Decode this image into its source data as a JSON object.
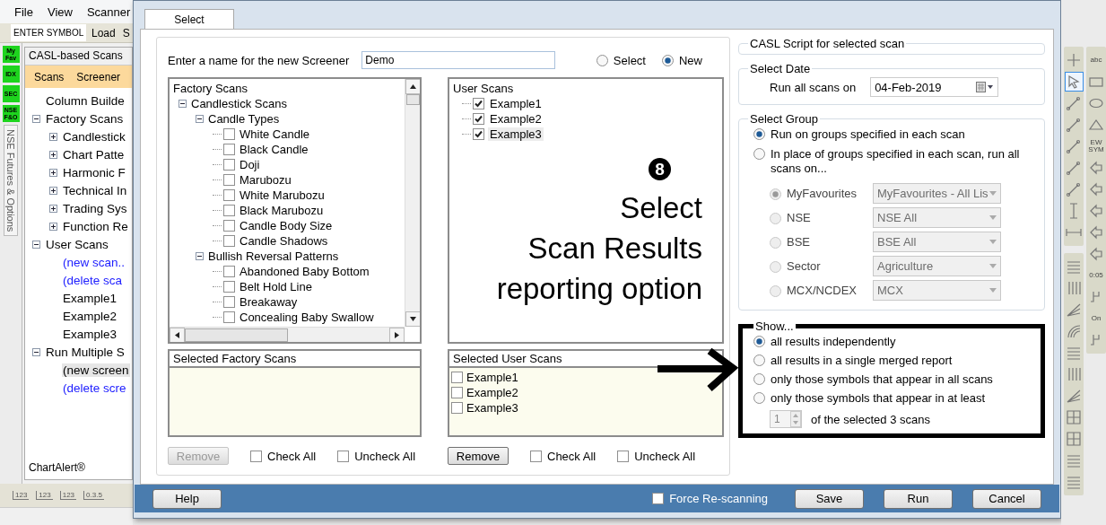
{
  "app": {
    "menu": [
      "File",
      "View",
      "Scanner"
    ],
    "symbol_field": {
      "placeholder": "ENTER SYMBOL"
    },
    "toolbar": [
      "Load",
      "S"
    ],
    "badges": [
      "My Fav",
      "IDX",
      "SEC",
      "NSE F&O"
    ],
    "side_tab": "NSE Futures & Options",
    "panel_title": "CASL-based Scans",
    "panel_menu": [
      "Scans",
      "Screener"
    ],
    "tree": [
      {
        "label": "Column Builde",
        "link": false,
        "selected": false
      },
      {
        "label": "Factory Scans",
        "link": false,
        "selected": false,
        "expanded": true,
        "children": [
          {
            "label": "Candlestick",
            "link": false,
            "selected": false,
            "expanded": false
          },
          {
            "label": "Chart Patte",
            "link": false,
            "selected": false,
            "expanded": false
          },
          {
            "label": "Harmonic F",
            "link": false,
            "selected": false,
            "expanded": false
          },
          {
            "label": "Technical In",
            "link": false,
            "selected": false,
            "expanded": false
          },
          {
            "label": "Trading Sys",
            "link": false,
            "selected": false,
            "expanded": false
          },
          {
            "label": "Function Re",
            "link": false,
            "selected": false,
            "expanded": false
          }
        ]
      },
      {
        "label": "User Scans",
        "link": false,
        "selected": false,
        "expanded": true,
        "children": [
          {
            "label": "(new scan..",
            "link": true,
            "selected": false
          },
          {
            "label": "(delete sca",
            "link": true,
            "selected": false
          },
          {
            "label": "Example1",
            "link": false,
            "selected": false
          },
          {
            "label": "Example2",
            "link": false,
            "selected": false
          },
          {
            "label": "Example3",
            "link": false,
            "selected": false
          }
        ]
      },
      {
        "label": "Run Multiple S",
        "link": false,
        "selected": false,
        "expanded": true,
        "children": [
          {
            "label": "(new screen",
            "link": false,
            "selected": true
          },
          {
            "label": "(delete scre",
            "link": true,
            "selected": false
          }
        ]
      }
    ],
    "footer": "ChartAlert®",
    "bottom_tools": [
      "123",
      "123",
      "123",
      "0.3.5"
    ]
  },
  "dialog": {
    "tabs": [
      {
        "label": "Select",
        "selected": true
      }
    ],
    "name_label": "Enter a name for the new Screener",
    "name_value": "Demo",
    "modes": [
      {
        "label": "Select",
        "selected": false
      },
      {
        "label": "New",
        "selected": true
      }
    ],
    "factory_scans": {
      "title": "Factory Scans",
      "children": [
        {
          "label": "Candlestick Scans",
          "expanded": true,
          "children": [
            {
              "label": "Candle Types",
              "expanded": true,
              "children": [
                {
                  "label": "White Candle",
                  "checked": false
                },
                {
                  "label": "Black Candle",
                  "checked": false
                },
                {
                  "label": "Doji",
                  "checked": false
                },
                {
                  "label": "Marubozu",
                  "checked": false
                },
                {
                  "label": "White Marubozu",
                  "checked": false
                },
                {
                  "label": "Black Marubozu",
                  "checked": false
                },
                {
                  "label": "Candle Body Size",
                  "checked": false
                },
                {
                  "label": "Candle Shadows",
                  "checked": false
                }
              ]
            },
            {
              "label": "Bullish Reversal Patterns",
              "expanded": true,
              "children": [
                {
                  "label": "Abandoned Baby Bottom",
                  "checked": false
                },
                {
                  "label": "Belt Hold Line",
                  "checked": false
                },
                {
                  "label": "Breakaway",
                  "checked": false
                },
                {
                  "label": "Concealing Baby Swallow",
                  "checked": false
                }
              ]
            }
          ]
        }
      ]
    },
    "user_scans": {
      "title": "User Scans",
      "items": [
        {
          "label": "Example1",
          "checked": true,
          "selected": false
        },
        {
          "label": "Example2",
          "checked": true,
          "selected": false
        },
        {
          "label": "Example3",
          "checked": true,
          "selected": true
        }
      ]
    },
    "selected_factory": {
      "title": "Selected Factory Scans",
      "remove": {
        "label": "Remove",
        "disabled": true
      },
      "check_all": {
        "label": "Check All",
        "checked": false
      },
      "uncheck_all": {
        "label": "Uncheck All",
        "checked": false
      }
    },
    "selected_user": {
      "title": "Selected User Scans",
      "items": [
        {
          "label": "Example1",
          "checked": false
        },
        {
          "label": "Example2",
          "checked": false
        },
        {
          "label": "Example3",
          "checked": false
        }
      ],
      "remove": {
        "label": "Remove",
        "disabled": false
      },
      "check_all": {
        "label": "Check All",
        "checked": false
      },
      "uncheck_all": {
        "label": "Uncheck All",
        "checked": false
      }
    },
    "annotation": {
      "number": "8",
      "lines": [
        "Select",
        "Scan Results",
        "reporting option"
      ]
    },
    "casl_script": {
      "title": "CASL Script for selected scan"
    },
    "select_date": {
      "title": "Select Date",
      "label": "Run all scans on",
      "value": "04-Feb-2019"
    },
    "select_group": {
      "title": "Select Group",
      "options": [
        {
          "label": "Run on groups specified in each scan",
          "selected": true
        },
        {
          "label": "In place of groups specified in each scan, run all scans on...",
          "selected": false
        }
      ],
      "groups": [
        {
          "label": "MyFavourites",
          "value": "MyFavourites - All Lis",
          "selected": true,
          "disabled": true
        },
        {
          "label": "NSE",
          "value": "NSE All",
          "selected": false,
          "disabled": true
        },
        {
          "label": "BSE",
          "value": "BSE All",
          "selected": false,
          "disabled": true
        },
        {
          "label": "Sector",
          "value": "Agriculture",
          "selected": false,
          "disabled": true
        },
        {
          "label": "MCX/NCDEX",
          "value": "MCX",
          "selected": false,
          "disabled": true
        }
      ]
    },
    "show": {
      "title": "Show...",
      "options": [
        {
          "label": "all results independently",
          "selected": true
        },
        {
          "label": "all results in a single merged report",
          "selected": false
        },
        {
          "label": "only those symbols that appear in all scans",
          "selected": false
        },
        {
          "label": "only those symbols that appear in at least",
          "selected": false
        }
      ],
      "spinner": "1",
      "spinner_suffix": "of the selected 3 scans"
    },
    "footer": {
      "help": "Help",
      "force": {
        "label": "Force Re-scanning",
        "checked": false
      },
      "buttons": [
        "Save",
        "Run",
        "Cancel"
      ]
    }
  },
  "tool_palettes": {
    "left_top": [
      {
        "kind": "plus",
        "selected": false
      },
      {
        "kind": "pointer",
        "selected": true
      },
      {
        "kind": "line",
        "selected": false
      },
      {
        "kind": "line",
        "selected": false
      },
      {
        "kind": "line",
        "selected": false
      },
      {
        "kind": "line",
        "selected": false
      },
      {
        "kind": "line",
        "selected": false
      },
      {
        "kind": "vline",
        "selected": false
      },
      {
        "kind": "hline",
        "selected": false
      }
    ],
    "left_bottom": [
      {
        "kind": "hlines",
        "selected": false
      },
      {
        "kind": "vlines",
        "selected": false
      },
      {
        "kind": "fan",
        "selected": false
      },
      {
        "kind": "arc",
        "selected": false
      },
      {
        "kind": "hlines",
        "selected": false
      },
      {
        "kind": "vlines",
        "selected": false
      },
      {
        "kind": "fan",
        "selected": false
      },
      {
        "kind": "grid",
        "selected": false
      },
      {
        "kind": "grid",
        "selected": false
      },
      {
        "kind": "hlines",
        "selected": false
      },
      {
        "kind": "hlines",
        "selected": false
      }
    ],
    "right": [
      {
        "kind": "text",
        "label": "abc",
        "selected": false
      },
      {
        "kind": "rect",
        "selected": false
      },
      {
        "kind": "ellipse",
        "selected": false
      },
      {
        "kind": "triangle",
        "selected": false
      },
      {
        "kind": "text",
        "label": "EW SYM",
        "selected": false
      },
      {
        "kind": "arrow",
        "selected": false
      },
      {
        "kind": "arrow",
        "selected": false
      },
      {
        "kind": "arrow",
        "selected": false
      },
      {
        "kind": "arrow",
        "selected": false
      },
      {
        "kind": "arrow",
        "selected": false
      },
      {
        "kind": "text",
        "label": "0:05",
        "selected": false
      },
      {
        "kind": "glyph",
        "selected": false
      },
      {
        "kind": "text",
        "label": "On",
        "selected": false
      },
      {
        "kind": "glyph",
        "selected": false
      }
    ]
  }
}
